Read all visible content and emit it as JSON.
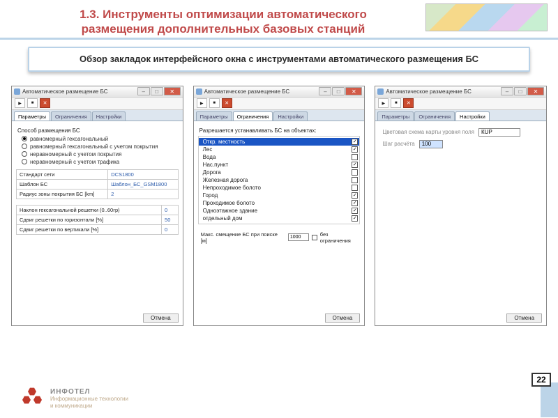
{
  "slide": {
    "title": "1.3. Инструменты оптимизации автоматического размещения дополнительных базовых станций",
    "subtitle": "Обзор закладок интерфейсного окна с инструментами автоматического размещения БС",
    "page_number": "22"
  },
  "brand": {
    "name": "ИНФОТЕЛ",
    "tagline1": "Информационные технологии",
    "tagline2": "и коммуникации"
  },
  "window_common": {
    "title": "Автоматическое размещение БС",
    "tabs": [
      "Параметры",
      "Ограничения",
      "Настройки"
    ],
    "cancel": "Отмена"
  },
  "win1": {
    "group_label": "Способ размещения БС",
    "radios": [
      {
        "label": "равномерный гексагональный",
        "selected": true
      },
      {
        "label": "равномерный гексагональный с учетом покрытия",
        "selected": false
      },
      {
        "label": "неравномерный с учетом покрытия",
        "selected": false
      },
      {
        "label": "неравномерный с учетом трафика",
        "selected": false
      }
    ],
    "params_top": [
      {
        "k": "Стандарт сети",
        "v": "DCS1800"
      },
      {
        "k": "Шаблон БС",
        "v": "Шаблон_БС_GSM1800"
      },
      {
        "k": "Радиус зоны покрытия БС [km]",
        "v": "2"
      }
    ],
    "params_bot": [
      {
        "k": "Наклон гексагональной решетки (0..60гр)",
        "v": "0"
      },
      {
        "k": "Сдвиг решетки по горизонтали [%]",
        "v": "50"
      },
      {
        "k": "Сдвиг решетки по вертикали [%]",
        "v": "0"
      }
    ]
  },
  "win2": {
    "group_label": "Разрешается устанавливать БС на объектах:",
    "items": [
      {
        "label": "Откр. местность",
        "checked": true,
        "selected": true
      },
      {
        "label": "Лес",
        "checked": true
      },
      {
        "label": "Вода",
        "checked": false
      },
      {
        "label": "Нас.пункт",
        "checked": true
      },
      {
        "label": "Дорога",
        "checked": false
      },
      {
        "label": "Железная дорога",
        "checked": false
      },
      {
        "label": "Непроходимое болото",
        "checked": false
      },
      {
        "label": "Город",
        "checked": true
      },
      {
        "label": "Проходимое болото",
        "checked": true
      },
      {
        "label": "Одноэтажное здание",
        "checked": true
      },
      {
        "label": "отдельный дом",
        "checked": true
      }
    ],
    "offset_label": "Макс. смещение БС при поиске [м]",
    "offset_value": "1000",
    "unlimited_label": "без ограничения"
  },
  "win3": {
    "rows": [
      {
        "label": "Цветовая схема карты уровня поля",
        "value": "КUP",
        "wide": true
      },
      {
        "label": "Шаг расчёта",
        "value": "100",
        "wide": false
      }
    ]
  }
}
